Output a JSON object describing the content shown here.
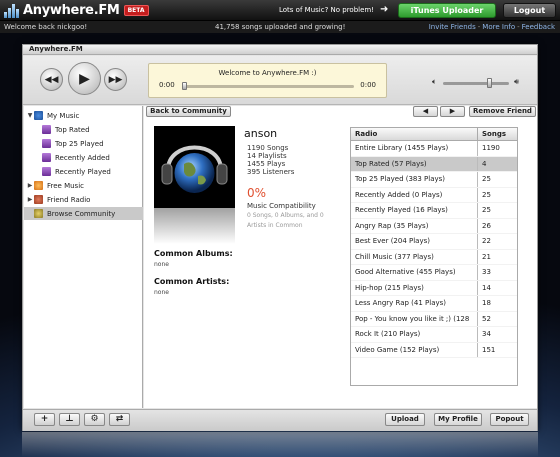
{
  "app": {
    "logo": "Anywhere.FM",
    "beta": "BETA",
    "window_title": "Anywhere.FM"
  },
  "topbar": {
    "promo": "Lots of Music?  No problem!",
    "itunes_button": "iTunes Uploader",
    "logout_button": "Logout"
  },
  "subbar": {
    "welcome": "Welcome back nickgoo!",
    "stats": "41,758 songs uploaded and growing!",
    "links": [
      "Invite Friends",
      "More Info",
      "Feedback"
    ]
  },
  "player": {
    "now_playing": "Welcome to Anywhere.FM :)",
    "elapsed": "0:00",
    "remaining": "0:00",
    "progress": 0,
    "volume": 0.72
  },
  "sidebar": {
    "items": [
      {
        "label": "My Music",
        "icon": "music-icon",
        "arrow": "▼"
      },
      {
        "label": "Top Rated",
        "icon": "playlist-icon"
      },
      {
        "label": "Top 25 Played",
        "icon": "playlist-icon"
      },
      {
        "label": "Recently Added",
        "icon": "playlist-icon"
      },
      {
        "label": "Recently Played",
        "icon": "playlist-icon"
      },
      {
        "label": "Free Music",
        "icon": "free-music-icon",
        "arrow": "▶"
      },
      {
        "label": "Friend Radio",
        "icon": "friend-radio-icon",
        "arrow": "▶"
      },
      {
        "label": "Browse Community",
        "icon": "browse-icon",
        "selected": true
      }
    ]
  },
  "profile": {
    "back_button": "Back to Community",
    "remove_button": "Remove Friend",
    "name": "anson",
    "songs": "1190 Songs",
    "playlists": "14 Playlists",
    "plays": "1455 Plays",
    "listeners": "395 Listeners",
    "compat_pct": "0%",
    "compat_label": "Music Compatibility",
    "compat_detail": "0 Songs, 0 Albums, and 0 Artists in Common",
    "common_albums_title": "Common Albums:",
    "common_albums_value": "none",
    "common_artists_title": "Common Artists:",
    "common_artists_value": "none"
  },
  "radio_table": {
    "headers": [
      "Radio",
      "Songs"
    ],
    "rows": [
      {
        "name": "Entire Library (1455 Plays)",
        "songs": "1190"
      },
      {
        "name": "Top Rated (57 Plays)",
        "songs": "4",
        "selected": true
      },
      {
        "name": "Top 25 Played (383 Plays)",
        "songs": "25"
      },
      {
        "name": "Recently Added (0 Plays)",
        "songs": "25"
      },
      {
        "name": "Recently Played (16 Plays)",
        "songs": "25"
      },
      {
        "name": "Angry Rap (35 Plays)",
        "songs": "26"
      },
      {
        "name": "Best Ever (204 Plays)",
        "songs": "22"
      },
      {
        "name": "Chill Music (377 Plays)",
        "songs": "21"
      },
      {
        "name": "Good Alternative (455 Plays)",
        "songs": "33"
      },
      {
        "name": "Hip-hop (215 Plays)",
        "songs": "14"
      },
      {
        "name": "Less Angry Rap (41 Plays)",
        "songs": "18"
      },
      {
        "name": "Pop - You know you like it ;) (128",
        "songs": "52"
      },
      {
        "name": "Rock It (210 Plays)",
        "songs": "34"
      },
      {
        "name": "Video Game (152 Plays)",
        "songs": "151"
      }
    ]
  },
  "bottombar": {
    "upload": "Upload",
    "my_profile": "My Profile",
    "popout": "Popout"
  },
  "colors": {
    "accent_green": "#2e9b2e",
    "beta_red": "#c31d1d",
    "compat_red": "#e05030",
    "now_playing_bg": "#fcf7d9"
  }
}
